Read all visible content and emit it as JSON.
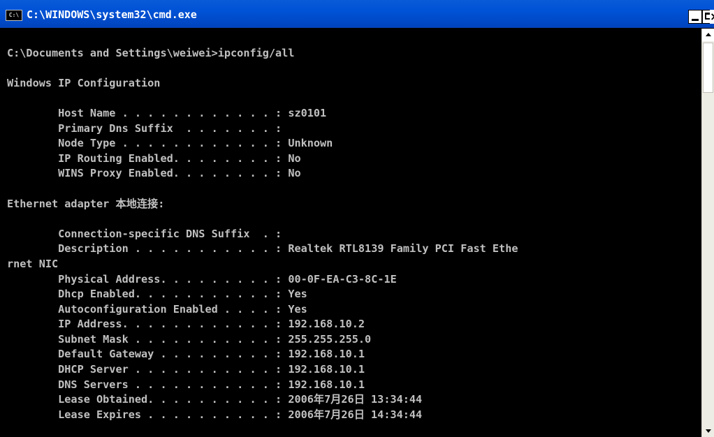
{
  "window": {
    "title": "C:\\WINDOWS\\system32\\cmd.exe",
    "icon_text": "C:\\"
  },
  "console": {
    "lines": [
      "",
      "C:\\Documents and Settings\\weiwei>ipconfig/all",
      "",
      "Windows IP Configuration",
      "",
      "        Host Name . . . . . . . . . . . . : sz0101",
      "        Primary Dns Suffix  . . . . . . . :",
      "        Node Type . . . . . . . . . . . . : Unknown",
      "        IP Routing Enabled. . . . . . . . : No",
      "        WINS Proxy Enabled. . . . . . . . : No",
      "",
      "Ethernet adapter 本地连接:",
      "",
      "        Connection-specific DNS Suffix  . :",
      "        Description . . . . . . . . . . . : Realtek RTL8139 Family PCI Fast Ethe",
      "rnet NIC",
      "        Physical Address. . . . . . . . . : 00-0F-EA-C3-8C-1E",
      "        Dhcp Enabled. . . . . . . . . . . : Yes",
      "        Autoconfiguration Enabled . . . . : Yes",
      "        IP Address. . . . . . . . . . . . : 192.168.10.2",
      "        Subnet Mask . . . . . . . . . . . : 255.255.255.0",
      "        Default Gateway . . . . . . . . . : 192.168.10.1",
      "        DHCP Server . . . . . . . . . . . : 192.168.10.1",
      "        DNS Servers . . . . . . . . . . . : 192.168.10.1",
      "        Lease Obtained. . . . . . . . . . : 2006年7月26日 13:34:44",
      "        Lease Expires . . . . . . . . . . : 2006年7月26日 14:34:44"
    ]
  },
  "colors": {
    "titlebar": "#0052d6",
    "console_bg": "#000000",
    "console_text": "#c0c0c0"
  }
}
